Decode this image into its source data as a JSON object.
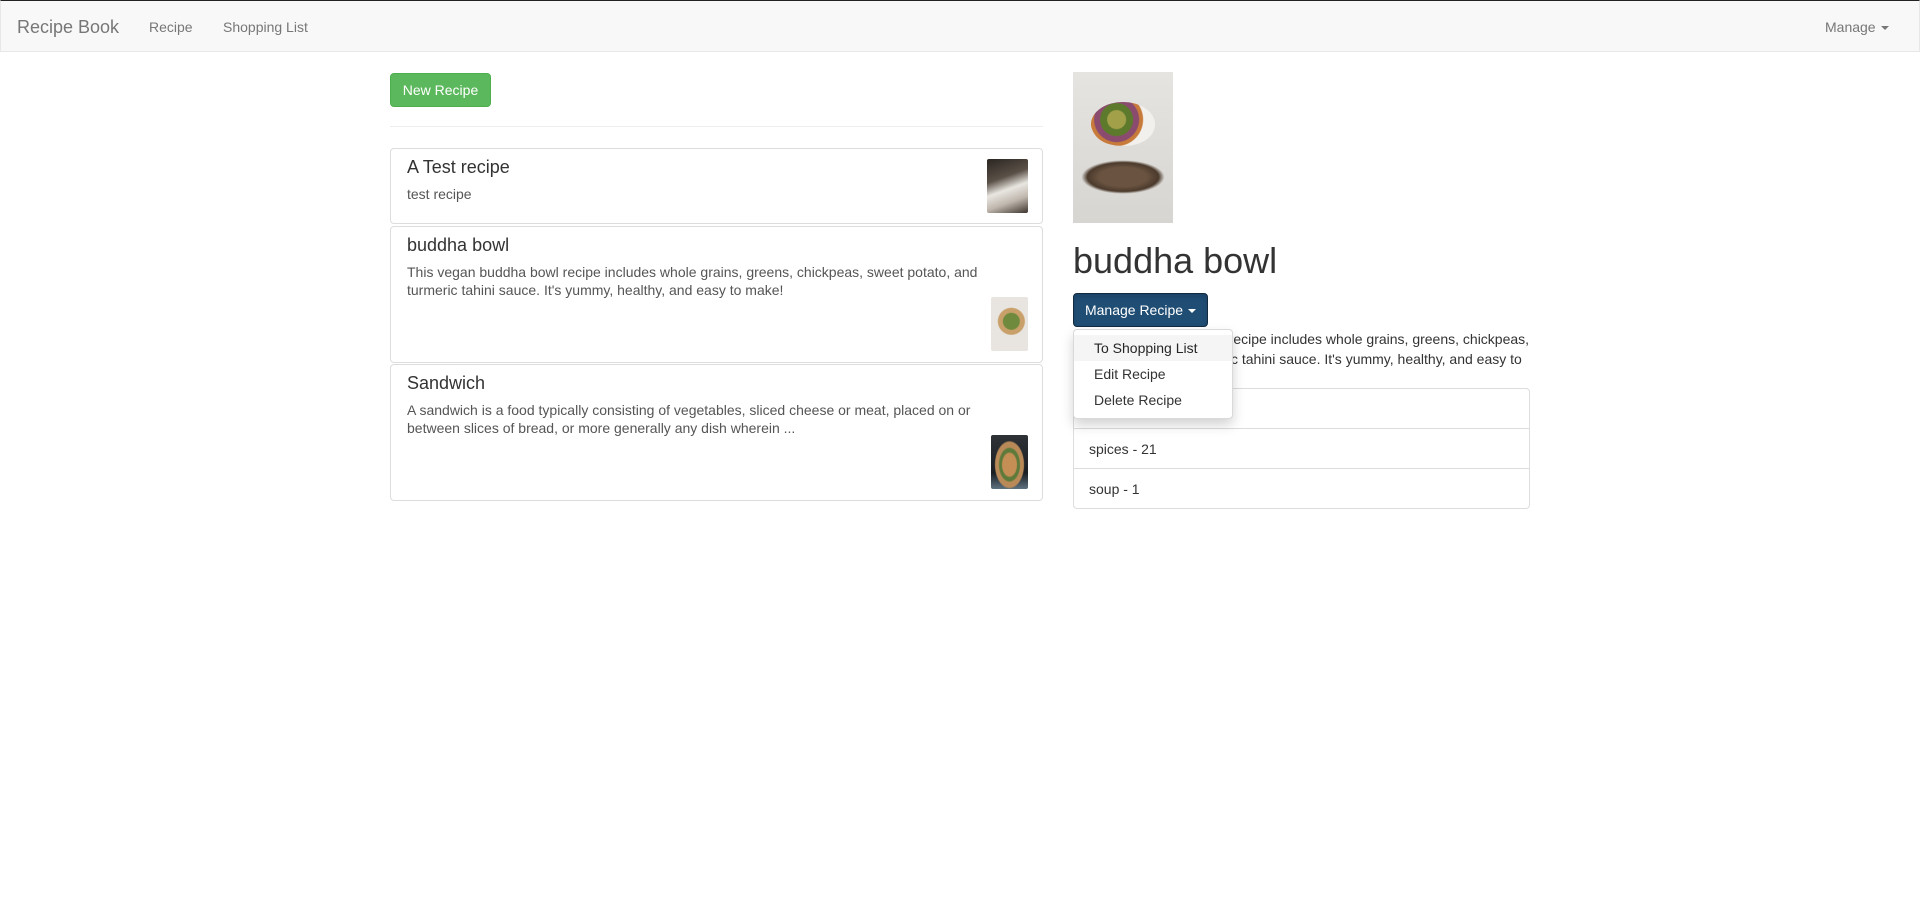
{
  "navbar": {
    "brand": "Recipe Book",
    "links": [
      "Recipe",
      "Shopping List"
    ],
    "manage_label": "Manage"
  },
  "left": {
    "new_recipe_label": "New Recipe",
    "recipes": [
      {
        "name": "A Test recipe",
        "description": "test recipe"
      },
      {
        "name": "buddha bowl",
        "description": "This vegan buddha bowl recipe includes whole grains, greens, chickpeas, sweet potato, and turmeric tahini sauce. It's yummy, healthy, and easy to make!"
      },
      {
        "name": "Sandwich",
        "description": "A sandwich is a food typically consisting of vegetables, sliced cheese or meat, placed on or between slices of bread, or more generally any dish wherein ..."
      }
    ]
  },
  "detail": {
    "title": "buddha bowl",
    "manage_button_label": "Manage Recipe",
    "dropdown_items": [
      "To Shopping List",
      "Edit Recipe",
      "Delete Recipe"
    ],
    "description": "This vegan buddha bowl recipe includes whole grains, greens, chickpeas, sweet potato, and turmeric tahini sauce. It's yummy, healthy, and easy to make!",
    "ingredients": [
      "",
      "spices - 21",
      "soup - 1"
    ]
  },
  "colors": {
    "success_button": "#5cb85c",
    "primary_active_button": "#204d74",
    "navbar_bg": "#f8f8f8"
  }
}
